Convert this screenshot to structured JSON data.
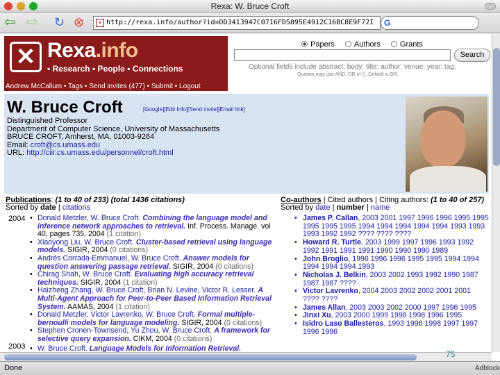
{
  "window": {
    "title": "Rexa: W. Bruce Croft"
  },
  "toolbar": {
    "url": "http://rexa.info/author?id=DD3413947C0716FD5895E4912C16BC8E9F72I",
    "search_placeholder": ""
  },
  "site": {
    "brand_main": "Rexa",
    "brand_suffix": ".info",
    "tagline": "▪ Research ▪ People ▪ Connections",
    "user_links": "Andrew McCallum • Tags • Send invites (477) • Submit • Logout",
    "search_options": [
      "Papers",
      "Authors",
      "Grants"
    ],
    "search_button": "Search",
    "optional_fields": "Optional fields include abstract: body: title: author: venue: year: tag:",
    "queries_note": "Queries may use AND, OR or (). Default is OR."
  },
  "profile": {
    "name": "W. Bruce Croft",
    "links": "[Google][Edit Info][Send invite][Email link]",
    "title": "Distinguished Professor",
    "dept": "Department of Computer Science, University of Massachusetts",
    "address": "BRUCE CROFT, Amherst, MA, 01003-9264",
    "email_label": "Email: ",
    "email": "croft@cs.umass.edu",
    "url_label": "URL: ",
    "url": "http://ciir.cs.umass.edu/personnel/croft.html"
  },
  "publications": {
    "heading": "Publications",
    "count": "(1 to 40 of 233) (total 1436 citations)",
    "sorted_by": "Sorted by",
    "sort_active": "date",
    "sort_other": "citations",
    "groups": [
      {
        "year": "2004",
        "items": [
          {
            "authors": "Donald Metzler, W. Bruce Croft.",
            "title": "Combining the language model and inference network approaches to retrieval.",
            "venue": " Inf. Process. Manage. vol 40, pages 735, 2004",
            "cites": " (1 citation)"
          },
          {
            "authors": "Xiaoyong Liu, W. Bruce Croft.",
            "title": "Cluster-based retrieval using language models.",
            "venue": " SIGIR, 2004",
            "cites": " (0 citations)"
          },
          {
            "authors": "Andrés Corrada-Emmanuel, W. Bruce Croft.",
            "title": "Answer models for question answering passage retrieval.",
            "venue": " SIGIR, 2004",
            "cites": " (0 citations)"
          },
          {
            "authors": "Chirag Shah, W. Bruce Croft.",
            "title": "Evaluating high accuracy retrieval techniques.",
            "venue": " SIGIR, 2004",
            "cites": " (1 citation)"
          },
          {
            "authors": "Haizheng Zhang, W. Bruce Croft, Brian N. Levine, Victor R. Lesser.",
            "title": "A Multi-Agent Approach for Peer-to-Peer Based Information Retrieval System.",
            "venue": " AAMAS, 2004",
            "cites": " (1 citation)"
          },
          {
            "authors": "Donald Metzler, Victor Lavrenko, W. Bruce Croft.",
            "title": "Formal multiple-bernoulli models for language modeling.",
            "venue": " SIGIR, 2004",
            "cites": " (0 citations)"
          },
          {
            "authors": "Stephen Cronen-Townsend, Yu Zhou, W. Bruce Croft.",
            "title": "A framework for selective query expansion.",
            "venue": " CIKM, 2004",
            "cites": " (0 citations)"
          }
        ]
      },
      {
        "year": "2003",
        "items": [
          {
            "authors": "W. Bruce Croft.",
            "title": "Language Models for Information Retrieval.",
            "venue": "",
            "cites": ""
          }
        ]
      }
    ]
  },
  "coauthors": {
    "tab_active": "Co-authors",
    "tab_2": "Cited authors",
    "tab_3": "Citing authors",
    "count": "(1 to 40 of 257)",
    "sorted_by": "Sorted by",
    "sort_1": "date",
    "sort_active": "number",
    "sort_3": "name",
    "items": [
      {
        "name": "James P. Callan",
        "years": ", 2003 2001 1997 1996 1996 1995 1995 1995 1995 1995 1994 1994 1994 1994 1994 1993 1993 1993 1992 1992 ???? ???? ????"
      },
      {
        "name": "Howard R. Turtle",
        "years": ", 2003 1999 1997 1996 1993 1992 1992 1991 1991 1991 1990 1990 1990 1989"
      },
      {
        "name": "John Broglio",
        "years": ", 1996 1996 1996 1995 1995 1994 1994 1994 1994 1994 1993"
      },
      {
        "name": "Nicholas J. Belkin",
        "years": ", 2003 2002 1993 1992 1990 1987 1987 1987 ????"
      },
      {
        "name": "Victor Lavrenko",
        "years": ", 2004 2003 2002 2002 2001 2001 ???? ????"
      },
      {
        "name": "James Allan",
        "years": ", 2003 2003 2002 2000 1997 1996 1995"
      },
      {
        "name": "Jinxi Xu",
        "years": ", 2003 2000 1999 1998 1998 1996 1995"
      },
      {
        "name": "Isidro Laso Ballesteros",
        "years": ", 1993 1996 1998 1997 1997 1996 1996"
      }
    ]
  },
  "status": {
    "left": "Done",
    "right": "Adblock",
    "slide_number": "75"
  }
}
